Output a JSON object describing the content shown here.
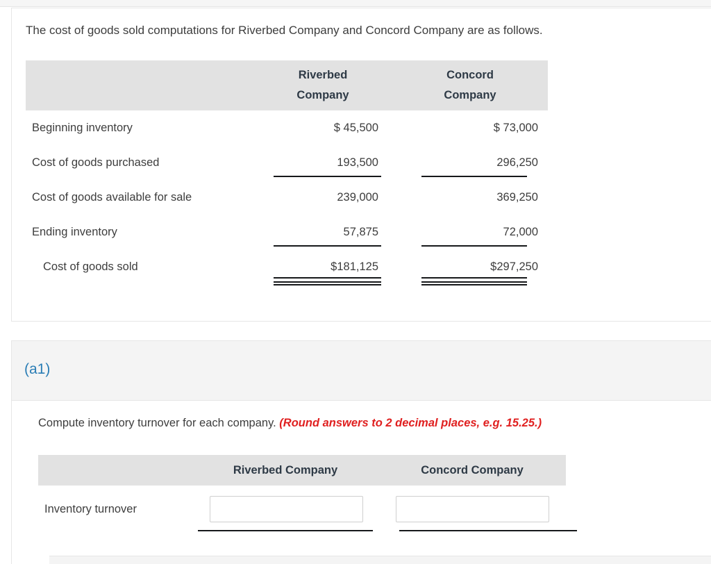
{
  "problem": {
    "intro": "The cost of goods sold computations for Riverbed Company and Concord Company are as follows.",
    "table": {
      "columns": [
        {
          "line1": "Riverbed",
          "line2": "Company"
        },
        {
          "line1": "Concord",
          "line2": "Company"
        }
      ],
      "rows": [
        {
          "label": "Beginning inventory",
          "riverbed": "$ 45,500",
          "concord": "$ 73,000",
          "rule": "none",
          "indent": false
        },
        {
          "label": "Cost of goods purchased",
          "riverbed": "193,500",
          "concord": "296,250",
          "rule": "single",
          "indent": false
        },
        {
          "label": "Cost of goods available for sale",
          "riverbed": "239,000",
          "concord": "369,250",
          "rule": "none",
          "indent": false
        },
        {
          "label": "Ending inventory",
          "riverbed": "57,875",
          "concord": "72,000",
          "rule": "single",
          "indent": false
        },
        {
          "label": "Cost of goods sold",
          "riverbed": "$181,125",
          "concord": "$297,250",
          "rule": "double",
          "indent": true
        }
      ]
    }
  },
  "question": {
    "part_label": "(a1)",
    "prompt_main": "Compute inventory turnover for each company. ",
    "prompt_hint": "(Round answers to 2 decimal places, e.g. 15.25.)",
    "table": {
      "columns": [
        "Riverbed Company",
        "Concord Company"
      ],
      "row_label": "Inventory turnover",
      "riverbed_value": "",
      "concord_value": "",
      "input_placeholder": ""
    }
  },
  "colors": {
    "header_gray": "#e2e2e2",
    "band_gray": "#f4f4f4",
    "part_label_blue": "#2a7db5",
    "hint_red": "#e02020",
    "text": "#3d3d3d",
    "rule": "#16181a"
  }
}
